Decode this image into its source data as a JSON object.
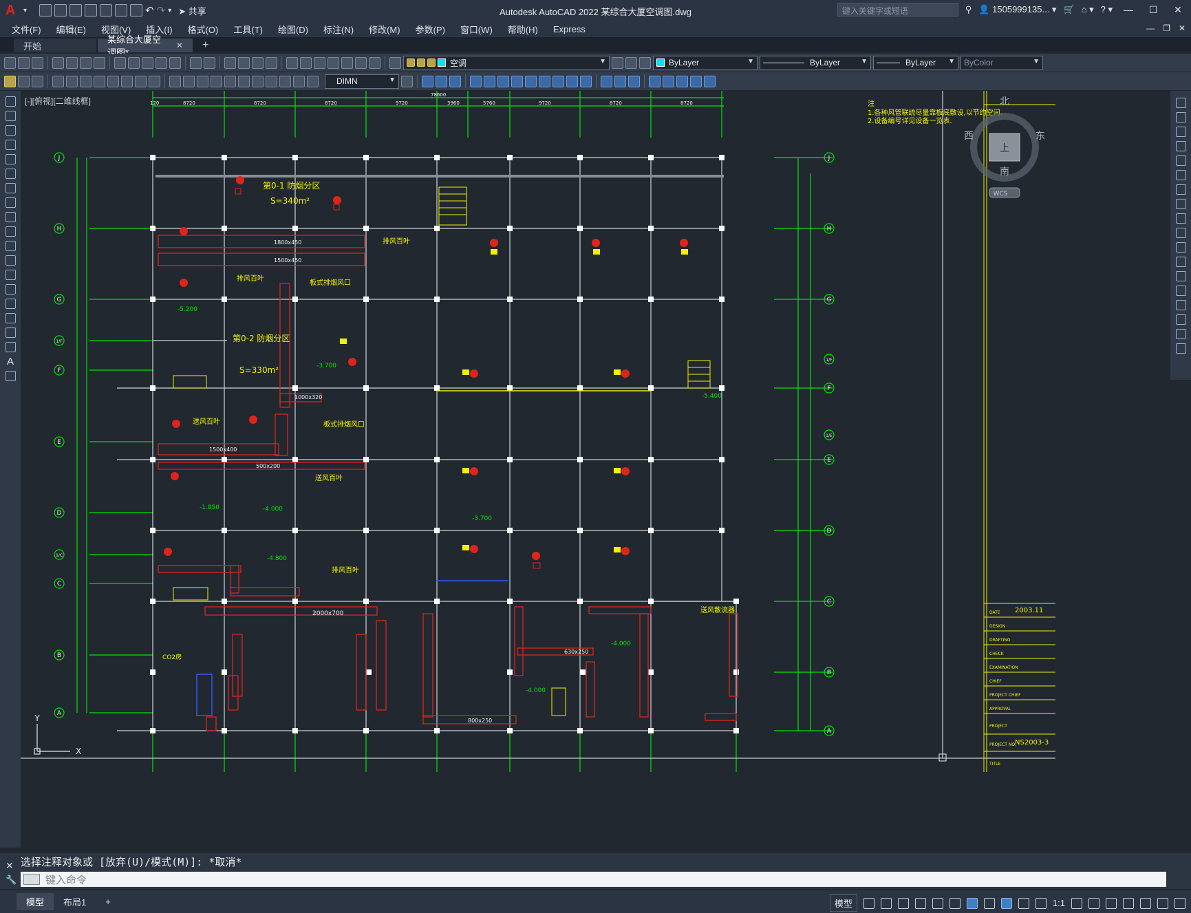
{
  "app": {
    "title": "Autodesk AutoCAD 2022    某综合大厦空调图.dwg",
    "logo": "A",
    "share_label": "共享",
    "search_placeholder": "键入关键字或短语",
    "user": "1505999135..."
  },
  "menu": [
    "文件(F)",
    "编辑(E)",
    "视图(V)",
    "插入(I)",
    "格式(O)",
    "工具(T)",
    "绘图(D)",
    "标注(N)",
    "修改(M)",
    "参数(P)",
    "窗口(W)",
    "帮助(H)",
    "Express"
  ],
  "tabs": [
    {
      "label": "开始",
      "closable": false,
      "active": false
    },
    {
      "label": "某综合大厦空调图*",
      "closable": true,
      "active": true
    }
  ],
  "tab_close_glyph": "✕",
  "tab_add_glyph": "+",
  "toolbar": {
    "layer_value": "空调",
    "color_value": "ByLayer",
    "linetype_value": "ByLayer",
    "lineweight_value": "ByLayer",
    "plotstyle_value": "ByColor",
    "dimstyle_value": "DIMN"
  },
  "viewport": {
    "label": "[-][俯视][二维线框]",
    "notes": [
      "注",
      "1.各种风管联统尽量靠板底敷设,以节约空间.",
      "2.设备编号详见设备一览表."
    ],
    "viewcube": {
      "north": "北",
      "south": "南",
      "east": "东",
      "west": "西",
      "top": "上",
      "wcs": "WCS"
    },
    "ucs": {
      "x": "X",
      "y": "Y"
    },
    "grid_rows": [
      "J",
      "H",
      "G",
      "1/F",
      "F",
      "E",
      "D",
      "1/C",
      "C",
      "B",
      "A"
    ],
    "grid_rows_right": [
      "J",
      "H",
      "G",
      "F",
      "1/F",
      "1/E",
      "E",
      "D",
      "C",
      "B",
      "A"
    ],
    "top_dims": [
      "120",
      "8720",
      "8720",
      "8720",
      "9720",
      "3960",
      "5760",
      "9720",
      "8720",
      "8720"
    ],
    "total_dim": "78600",
    "zones": [
      {
        "name": "第0-1  防烟分区",
        "area": "S=340m²"
      },
      {
        "name": "第0-2  防烟分区",
        "area": "S=330m²"
      }
    ],
    "labels": {
      "exhaust_louver": "排风百叶",
      "supply_louver": "送风百叶",
      "plate_vent": "板式排烟风口",
      "duct_1": "1800x450",
      "duct_2": "1500x450",
      "duct_3": "1000x320",
      "duct_4": "1500x400",
      "duct_5": "500x200",
      "duct_6": "2000x700",
      "duct_7": "630x250",
      "duct_8": "800x250",
      "elev_1": "-3.700",
      "elev_2": "-4.000",
      "elev_3": "-5.200",
      "elev_4": "-1.850",
      "elev_5": "-4.800",
      "elev_6": "-5.400",
      "supply_unit": "送风散流器",
      "co2": "CO2房"
    },
    "titleblock": {
      "date_label": "DATE",
      "date_value": "2003.11",
      "rows": [
        "DESIGN",
        "DRAFTING",
        "CHECK",
        "EXAMINATION",
        "CHIEF",
        "PROJECT CHIEF",
        "APPROVAL",
        "PROJECT",
        "PROJECT NO.",
        "TITLE"
      ],
      "project_no": "NS2003-3"
    }
  },
  "command": {
    "history": "选择注释对象或 [放弃(U)/模式(M)]: *取消*",
    "placeholder": "键入命令"
  },
  "status": {
    "tabs": [
      "模型",
      "布局1"
    ],
    "model_label": "模型",
    "scale": "1:1"
  },
  "colors": {
    "background": "#212830",
    "grid_line": "#cfd4da",
    "axis": "#00e600",
    "duct": "#e0241b",
    "text": "#f2f200",
    "accent": "#3f7fc5"
  }
}
